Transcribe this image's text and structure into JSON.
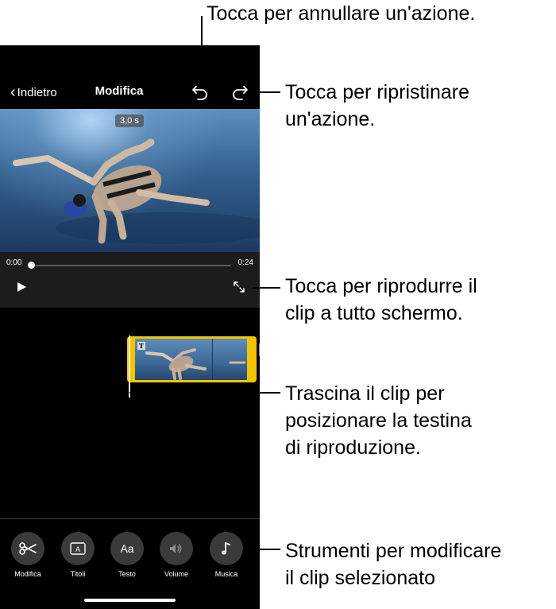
{
  "nav": {
    "back_label": "Indietro",
    "title": "Modifica"
  },
  "viewer": {
    "duration": "3,0 s"
  },
  "controls": {
    "time_start": "0:00",
    "time_end": "0:24",
    "progress": 0.0
  },
  "toolbar": {
    "items": [
      {
        "label": "Modifica",
        "icon": "scissors-icon"
      },
      {
        "label": "Titoli",
        "icon": "titles-icon"
      },
      {
        "label": "Testo",
        "icon": "text-icon"
      },
      {
        "label": "Volume",
        "icon": "speaker-icon"
      },
      {
        "label": "Musica",
        "icon": "music-note-icon"
      }
    ]
  },
  "callouts": {
    "undo": "Tocca per annullare un'azione.",
    "redo_line1": "Tocca per ripristinare",
    "redo_line2": "un'azione.",
    "fullscreen_line1": "Tocca per riprodurre il",
    "fullscreen_line2": "clip a tutto schermo.",
    "drag_line1": "Trascina il clip per",
    "drag_line2": "posizionare la testina",
    "drag_line3": "di riproduzione.",
    "tools_line1": "Strumenti per modificare",
    "tools_line2": "il clip selezionato"
  },
  "colors": {
    "accent_clip_border": "#f2c500",
    "background": "#000000",
    "control_bar": "#1c1c1e",
    "tool_button": "#3a3a3c"
  }
}
